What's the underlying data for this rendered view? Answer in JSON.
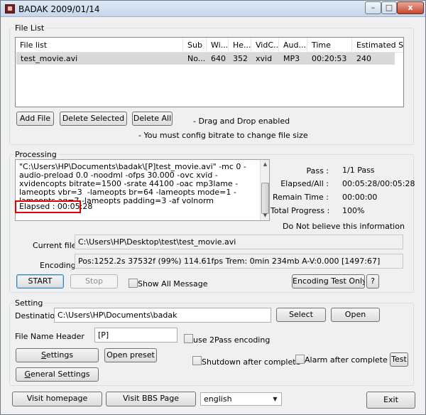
{
  "window": {
    "title": "BADAK 2009/01/14",
    "controls": {
      "minimize": "–",
      "maximize": "□",
      "close": "x"
    }
  },
  "file_list": {
    "group_label": "File List",
    "columns": [
      "File list",
      "Sub",
      "Wi...",
      "He...",
      "VidC...",
      "Aud...",
      "Time",
      "Estimated Siz..."
    ],
    "rows": [
      [
        "test_movie.avi",
        "No...",
        "640",
        "352",
        "xvid",
        "MP3",
        "00:20:53",
        "240"
      ]
    ],
    "add_file": "Add File",
    "delete_selected": "Delete Selected",
    "delete_all": "Delete All",
    "hint_drag": "- Drag and Drop enabled",
    "hint_bitrate": "- You must config bitrate to change file size"
  },
  "processing": {
    "group_label": "Processing",
    "log": "\"C:\\Users\\HP\\Documents\\badak\\[P]test_movie.avi\" -mc 0 -audio-preload 0.0 -noodml -ofps 30.000 -ovc xvid -xvidencopts bitrate=1500 -srate 44100 -oac mp3lame -lameopts vbr=3  -lameopts br=64 -lameopts mode=1 -lameopts aq=7 -lameopts padding=3 -af volnorm\nAll completed",
    "elapsed_line": "Elapsed : 00:05:28",
    "stats": [
      {
        "label": "Pass :",
        "value": "1/1 Pass"
      },
      {
        "label": "Elapsed/All :",
        "value": "00:05:28/00:05:28"
      },
      {
        "label": "Remain Time :",
        "value": "00:00:00"
      },
      {
        "label": "Total Progress :",
        "value": "100%"
      }
    ],
    "disclaimer": "Do Not believe this information",
    "current_file_label": "Current file :",
    "current_file": "C:\\Users\\HP\\Desktop\\test\\test_movie.avi",
    "encoding_label": "Encoding",
    "encoding_status": "Pos:1252.2s  37532f (99%) 114.61fps Trem:    0min 234mb  A-V:0.000 [1497:67]",
    "start": "START",
    "stop": "Stop",
    "show_all_message": "Show All Message",
    "encoding_test_only": "Encoding Test Only",
    "help": "?"
  },
  "setting": {
    "group_label": "Setting",
    "destination_label": "Destination",
    "destination": "C:\\Users\\HP\\Documents\\badak",
    "select": "Select",
    "open": "Open",
    "file_name_header_label": "File Name Header",
    "file_name_header": "[P]",
    "use_2pass": "use 2Pass encoding",
    "settings": "Settings",
    "open_preset": "Open preset",
    "shutdown_after": "Shutdown after complete",
    "alarm_after": "Alarm after complete",
    "test": "Test",
    "general_settings": "General Settings"
  },
  "bottom": {
    "visit_homepage": "Visit homepage",
    "visit_bbs": "Visit BBS Page",
    "language": "english",
    "exit": "Exit"
  }
}
